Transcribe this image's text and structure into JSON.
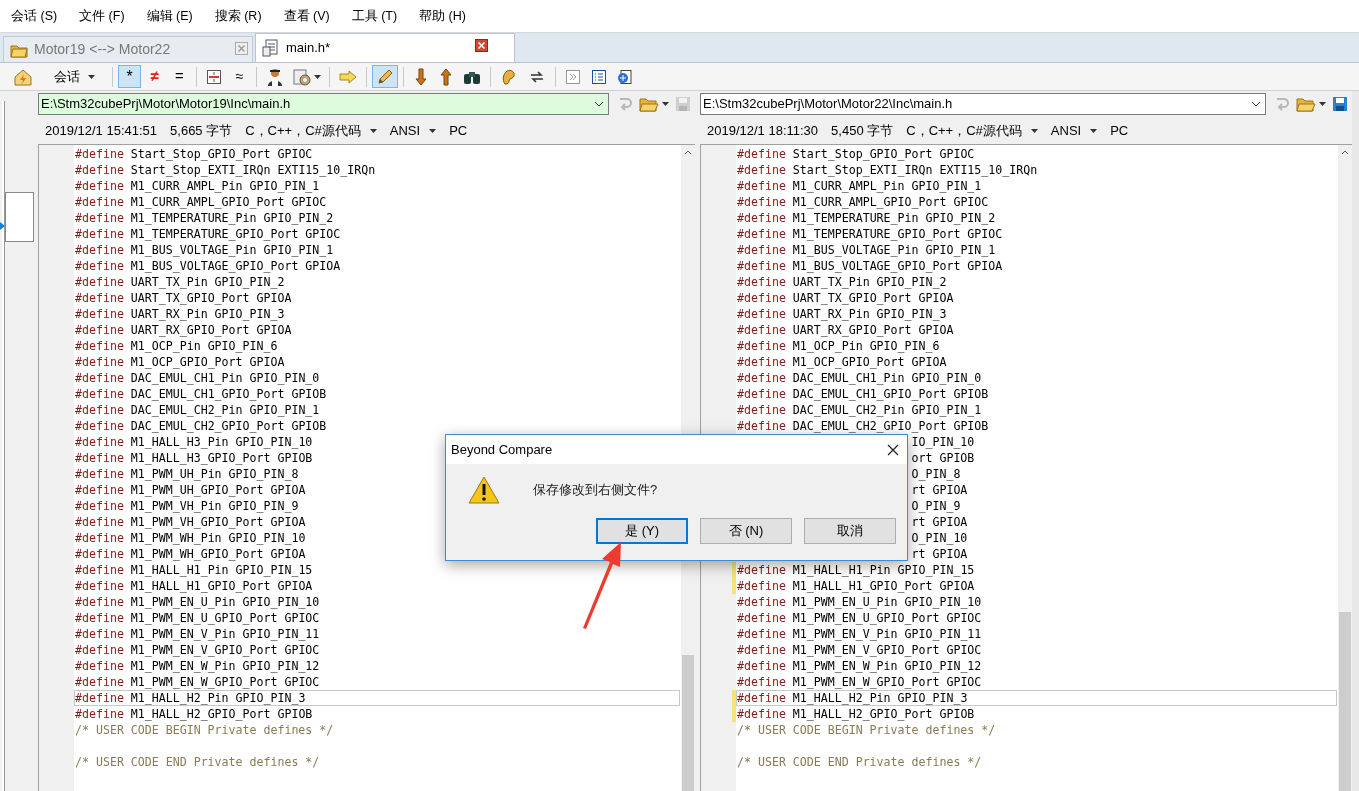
{
  "menu": [
    {
      "label": "会话 (S)"
    },
    {
      "label": "文件 (F)"
    },
    {
      "label": "编辑 (E)"
    },
    {
      "label": "搜索 (R)"
    },
    {
      "label": "查看 (V)"
    },
    {
      "label": "工具 (T)"
    },
    {
      "label": "帮助 (H)"
    }
  ],
  "tabs": [
    {
      "kind": "folder",
      "label": "Motor19 <--> Motor22",
      "selected": false
    },
    {
      "kind": "file",
      "label": "main.h*",
      "selected": true
    }
  ],
  "toolbar": {
    "session_label": "会话",
    "filters": [
      {
        "label": "*",
        "selected": true
      },
      {
        "label": "≠",
        "selected": false
      },
      {
        "label": "=",
        "selected": false
      }
    ],
    "similar_label": "≈",
    "edit_selected": true
  },
  "panes": [
    {
      "path": "E:\\Stm32cubePrj\\Motor\\Motor19\\Inc\\main.h",
      "highlighted": true,
      "save_enabled": false,
      "date": "2019/12/1 15:41:51",
      "size": "5,665 字节",
      "format": "C，C++，C#源代码",
      "encoding": "ANSI",
      "line_ending": "PC",
      "lines": [
        {
          "kind": "define",
          "keyword": "#define",
          "text": "Start_Stop_GPIO_Port GPIOC"
        },
        {
          "kind": "define",
          "keyword": "#define",
          "text": "Start_Stop_EXTI_IRQn EXTI15_10_IRQn"
        },
        {
          "kind": "define",
          "keyword": "#define",
          "text": "M1_CURR_AMPL_Pin GPIO_PIN_1"
        },
        {
          "kind": "define",
          "keyword": "#define",
          "text": "M1_CURR_AMPL_GPIO_Port GPIOC"
        },
        {
          "kind": "define",
          "keyword": "#define",
          "text": "M1_TEMPERATURE_Pin GPIO_PIN_2"
        },
        {
          "kind": "define",
          "keyword": "#define",
          "text": "M1_TEMPERATURE_GPIO_Port GPIOC"
        },
        {
          "kind": "define",
          "keyword": "#define",
          "text": "M1_BUS_VOLTAGE_Pin GPIO_PIN_1"
        },
        {
          "kind": "define",
          "keyword": "#define",
          "text": "M1_BUS_VOLTAGE_GPIO_Port GPIOA"
        },
        {
          "kind": "define",
          "keyword": "#define",
          "text": "UART_TX_Pin GPIO_PIN_2"
        },
        {
          "kind": "define",
          "keyword": "#define",
          "text": "UART_TX_GPIO_Port GPIOA"
        },
        {
          "kind": "define",
          "keyword": "#define",
          "text": "UART_RX_Pin GPIO_PIN_3"
        },
        {
          "kind": "define",
          "keyword": "#define",
          "text": "UART_RX_GPIO_Port GPIOA"
        },
        {
          "kind": "define",
          "keyword": "#define",
          "text": "M1_OCP_Pin GPIO_PIN_6"
        },
        {
          "kind": "define",
          "keyword": "#define",
          "text": "M1_OCP_GPIO_Port GPIOA"
        },
        {
          "kind": "define",
          "keyword": "#define",
          "text": "DAC_EMUL_CH1_Pin GPIO_PIN_0"
        },
        {
          "kind": "define",
          "keyword": "#define",
          "text": "DAC_EMUL_CH1_GPIO_Port GPIOB"
        },
        {
          "kind": "define",
          "keyword": "#define",
          "text": "DAC_EMUL_CH2_Pin GPIO_PIN_1"
        },
        {
          "kind": "define",
          "keyword": "#define",
          "text": "DAC_EMUL_CH2_GPIO_Port GPIOB"
        },
        {
          "kind": "define",
          "keyword": "#define",
          "text": "M1_HALL_H3_Pin GPIO_PIN_10"
        },
        {
          "kind": "define",
          "keyword": "#define",
          "text": "M1_HALL_H3_GPIO_Port GPIOB"
        },
        {
          "kind": "define",
          "keyword": "#define",
          "text": "M1_PWM_UH_Pin GPIO_PIN_8"
        },
        {
          "kind": "define",
          "keyword": "#define",
          "text": "M1_PWM_UH_GPIO_Port GPIOA"
        },
        {
          "kind": "define",
          "keyword": "#define",
          "text": "M1_PWM_VH_Pin GPIO_PIN_9"
        },
        {
          "kind": "define",
          "keyword": "#define",
          "text": "M1_PWM_VH_GPIO_Port GPIOA"
        },
        {
          "kind": "define",
          "keyword": "#define",
          "text": "M1_PWM_WH_Pin GPIO_PIN_10"
        },
        {
          "kind": "define",
          "keyword": "#define",
          "text": "M1_PWM_WH_GPIO_Port GPIOA"
        },
        {
          "kind": "define",
          "keyword": "#define",
          "text": "M1_HALL_H1_Pin GPIO_PIN_15"
        },
        {
          "kind": "define",
          "keyword": "#define",
          "text": "M1_HALL_H1_GPIO_Port GPIOA"
        },
        {
          "kind": "define",
          "keyword": "#define",
          "text": "M1_PWM_EN_U_Pin GPIO_PIN_10"
        },
        {
          "kind": "define",
          "keyword": "#define",
          "text": "M1_PWM_EN_U_GPIO_Port GPIOC"
        },
        {
          "kind": "define",
          "keyword": "#define",
          "text": "M1_PWM_EN_V_Pin GPIO_PIN_11"
        },
        {
          "kind": "define",
          "keyword": "#define",
          "text": "M1_PWM_EN_V_GPIO_Port GPIOC"
        },
        {
          "kind": "define",
          "keyword": "#define",
          "text": "M1_PWM_EN_W_Pin GPIO_PIN_12"
        },
        {
          "kind": "define",
          "keyword": "#define",
          "text": "M1_PWM_EN_W_GPIO_Port GPIOC"
        },
        {
          "kind": "define",
          "keyword": "#define",
          "text": "M1_HALL_H2_Pin GPIO_PIN_3",
          "current": true
        },
        {
          "kind": "define",
          "keyword": "#define",
          "text": "M1_HALL_H2_GPIO_Port GPIOB"
        },
        {
          "kind": "comment",
          "text": "/* USER CODE BEGIN Private defines */"
        },
        {
          "kind": "blank"
        },
        {
          "kind": "comment",
          "text": "/* USER CODE END Private defines */"
        }
      ]
    },
    {
      "path": "E:\\Stm32cubePrj\\Motor\\Motor22\\Inc\\main.h",
      "highlighted": false,
      "save_enabled": true,
      "date": "2019/12/1 18:11:30",
      "size": "5,450 字节",
      "format": "C，C++，C#源代码",
      "encoding": "ANSI",
      "line_ending": "PC",
      "lines": [
        {
          "kind": "define",
          "keyword": "#define",
          "text": "Start_Stop_GPIO_Port GPIOC"
        },
        {
          "kind": "define",
          "keyword": "#define",
          "text": "Start_Stop_EXTI_IRQn EXTI15_10_IRQn"
        },
        {
          "kind": "define",
          "keyword": "#define",
          "text": "M1_CURR_AMPL_Pin GPIO_PIN_1"
        },
        {
          "kind": "define",
          "keyword": "#define",
          "text": "M1_CURR_AMPL_GPIO_Port GPIOC"
        },
        {
          "kind": "define",
          "keyword": "#define",
          "text": "M1_TEMPERATURE_Pin GPIO_PIN_2"
        },
        {
          "kind": "define",
          "keyword": "#define",
          "text": "M1_TEMPERATURE_GPIO_Port GPIOC"
        },
        {
          "kind": "define",
          "keyword": "#define",
          "text": "M1_BUS_VOLTAGE_Pin GPIO_PIN_1"
        },
        {
          "kind": "define",
          "keyword": "#define",
          "text": "M1_BUS_VOLTAGE_GPIO_Port GPIOA"
        },
        {
          "kind": "define",
          "keyword": "#define",
          "text": "UART_TX_Pin GPIO_PIN_2"
        },
        {
          "kind": "define",
          "keyword": "#define",
          "text": "UART_TX_GPIO_Port GPIOA"
        },
        {
          "kind": "define",
          "keyword": "#define",
          "text": "UART_RX_Pin GPIO_PIN_3"
        },
        {
          "kind": "define",
          "keyword": "#define",
          "text": "UART_RX_GPIO_Port GPIOA"
        },
        {
          "kind": "define",
          "keyword": "#define",
          "text": "M1_OCP_Pin GPIO_PIN_6"
        },
        {
          "kind": "define",
          "keyword": "#define",
          "text": "M1_OCP_GPIO_Port GPIOA"
        },
        {
          "kind": "define",
          "keyword": "#define",
          "text": "DAC_EMUL_CH1_Pin GPIO_PIN_0"
        },
        {
          "kind": "define",
          "keyword": "#define",
          "text": "DAC_EMUL_CH1_GPIO_Port GPIOB"
        },
        {
          "kind": "define",
          "keyword": "#define",
          "text": "DAC_EMUL_CH2_Pin GPIO_PIN_1"
        },
        {
          "kind": "define",
          "keyword": "#define",
          "text": "DAC_EMUL_CH2_GPIO_Port GPIOB"
        },
        {
          "kind": "tail",
          "text": "IO_PIN_10"
        },
        {
          "kind": "tail",
          "text": "ort GPIOB"
        },
        {
          "kind": "tail",
          "text": "O_PIN_8"
        },
        {
          "kind": "tail",
          "text": "rt GPIOA"
        },
        {
          "kind": "tail",
          "text": "O_PIN_9"
        },
        {
          "kind": "tail",
          "text": "rt GPIOA"
        },
        {
          "kind": "tail",
          "text": "O_PIN_10"
        },
        {
          "kind": "tail",
          "text": "rt GPIOA"
        },
        {
          "kind": "define",
          "keyword": "#define",
          "text": "M1_HALL_H1_Pin GPIO_PIN_15",
          "changed": true
        },
        {
          "kind": "define",
          "keyword": "#define",
          "text": "M1_HALL_H1_GPIO_Port GPIOA",
          "changed": true
        },
        {
          "kind": "define",
          "keyword": "#define",
          "text": "M1_PWM_EN_U_Pin GPIO_PIN_10"
        },
        {
          "kind": "define",
          "keyword": "#define",
          "text": "M1_PWM_EN_U_GPIO_Port GPIOC"
        },
        {
          "kind": "define",
          "keyword": "#define",
          "text": "M1_PWM_EN_V_Pin GPIO_PIN_11"
        },
        {
          "kind": "define",
          "keyword": "#define",
          "text": "M1_PWM_EN_V_GPIO_Port GPIOC"
        },
        {
          "kind": "define",
          "keyword": "#define",
          "text": "M1_PWM_EN_W_Pin GPIO_PIN_12"
        },
        {
          "kind": "define",
          "keyword": "#define",
          "text": "M1_PWM_EN_W_GPIO_Port GPIOC"
        },
        {
          "kind": "define",
          "keyword": "#define",
          "text": "M1_HALL_H2_Pin GPIO_PIN_3",
          "current": true,
          "changed": true
        },
        {
          "kind": "define",
          "keyword": "#define",
          "text": "M1_HALL_H2_GPIO_Port GPIOB",
          "changed": true
        },
        {
          "kind": "comment",
          "text": "/* USER CODE BEGIN Private defines */"
        },
        {
          "kind": "blank"
        },
        {
          "kind": "comment",
          "text": "/* USER CODE END Private defines */"
        }
      ]
    }
  ],
  "dialog": {
    "title": "Beyond Compare",
    "message": "保存修改到右侧文件?",
    "buttons": [
      {
        "label": "是 (Y)",
        "default": true
      },
      {
        "label": "否 (N)",
        "default": false
      },
      {
        "label": "取消",
        "default": false
      }
    ]
  }
}
